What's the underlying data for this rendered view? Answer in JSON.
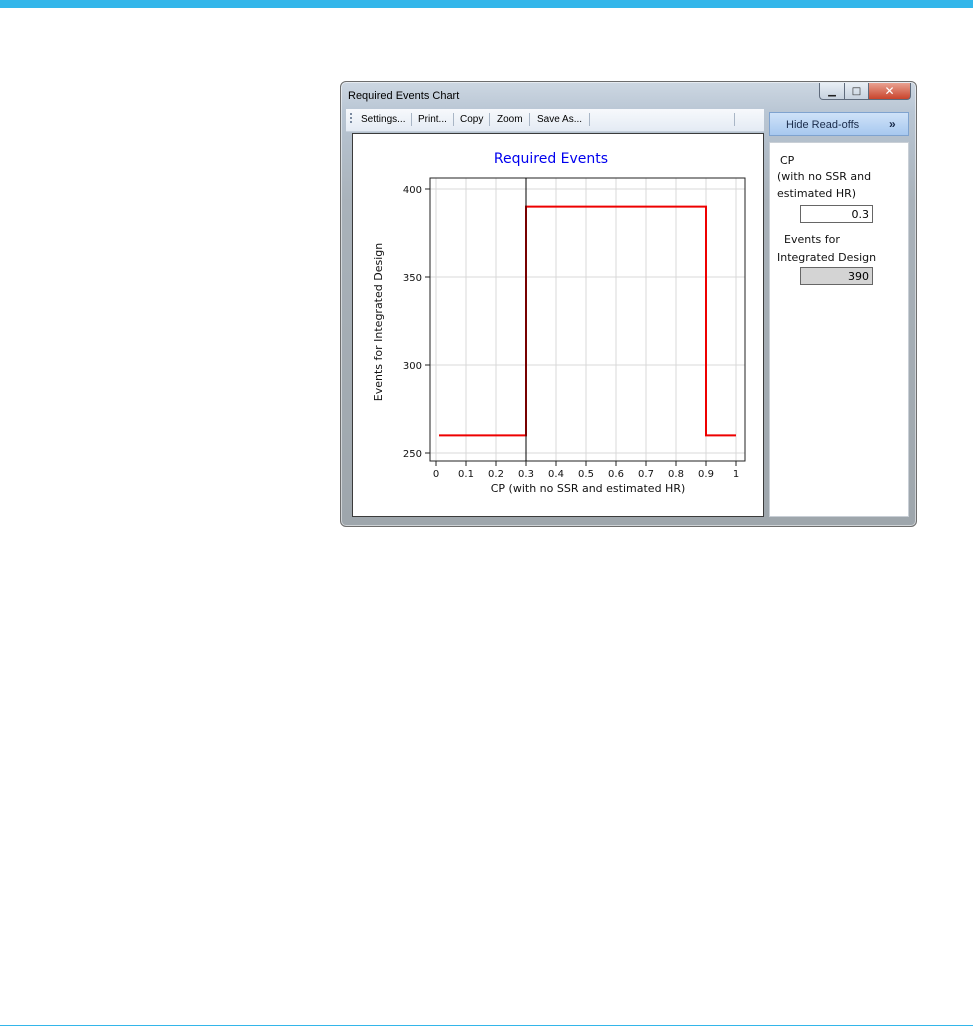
{
  "window": {
    "title": "Required Events Chart"
  },
  "window_controls": {
    "minimize": "▁",
    "maximize": "□",
    "close": "✕"
  },
  "toolbar": {
    "items": [
      {
        "label": "Settings..."
      },
      {
        "label": "Print..."
      },
      {
        "label": "Copy"
      },
      {
        "label": "Zoom"
      },
      {
        "label": "Save As..."
      }
    ]
  },
  "read_offs": {
    "toggle_label": "Hide Read-offs",
    "toggle_icon": "double-chevron-right-icon",
    "toggle_glyph": "»",
    "cp_label_line1": "CP",
    "cp_label_line2": "(with no SSR and",
    "cp_label_line3": "estimated HR)",
    "cp_value": "0.3",
    "events_label_line1": "Events for",
    "events_label_line2": "Integrated Design",
    "events_value": "390"
  },
  "colors": {
    "title": "#0000ee",
    "series": "#ee0000",
    "grid": "#d9d9d9",
    "cursor": "#000000",
    "readout_field_disabled": "#d4d4d4",
    "accent_bar": "#33b6ea"
  },
  "chart_data": {
    "type": "line",
    "title": "Required Events",
    "xlabel": "CP (with no SSR and estimated HR)",
    "ylabel": "Events for Integrated Design",
    "xlim": [
      0,
      1
    ],
    "ylim": [
      250,
      400
    ],
    "x_ticks": [
      0,
      0.1,
      0.2,
      0.3,
      0.4,
      0.5,
      0.6,
      0.7,
      0.8,
      0.9,
      1
    ],
    "x_tick_labels": [
      "0",
      "0.1",
      "0.2",
      "0.3",
      "0.4",
      "0.5",
      "0.6",
      "0.7",
      "0.8",
      "0.9",
      "1"
    ],
    "y_ticks": [
      250,
      300,
      350,
      400
    ],
    "y_tick_labels": [
      "250",
      "300",
      "350",
      "400"
    ],
    "grid": true,
    "series": [
      {
        "x": [
          0.01,
          0.3,
          0.3,
          0.9,
          0.9,
          1.0
        ],
        "y": [
          260,
          260,
          390,
          390,
          260,
          260
        ]
      }
    ],
    "cursor_x": 0.3
  }
}
